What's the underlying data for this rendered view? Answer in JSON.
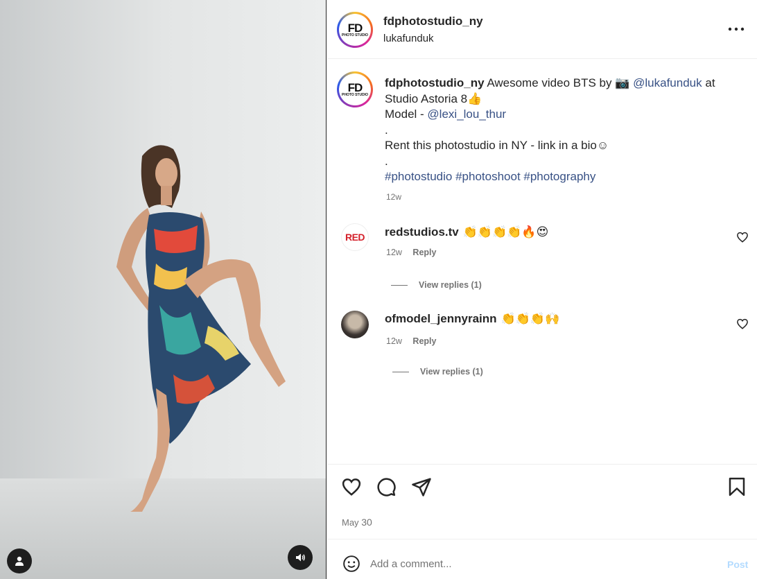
{
  "post": {
    "username": "fdphotostudio_ny",
    "subtitle": "lukafunduk",
    "avatar_text": "FD",
    "avatar_subtext": "PHOTO STUDIO"
  },
  "caption": {
    "username": "fdphotostudio_ny",
    "text_1": "Awesome video BTS by 📷",
    "mention_1": "@lukafunduk",
    "text_2": "at Studio Astoria 8👍",
    "model_prefix": "Model - ",
    "mention_2": "@lexi_lou_thur",
    "dot_1": ".",
    "rent_text": "Rent this photostudio in NY - link in a bio☺",
    "dot_2": ".",
    "hashtags": "#photostudio #photoshoot #photography",
    "time": "12w"
  },
  "comments": [
    {
      "username": "redstudios.tv",
      "emoji": "👏👏👏👏🔥😍",
      "time": "12w",
      "reply": "Reply",
      "view_replies": "View replies (1)",
      "avatar_text": "RED"
    },
    {
      "username": "ofmodel_jennyrainn",
      "emoji": "👏👏👏🙌",
      "time": "12w",
      "reply": "Reply",
      "view_replies": "View replies (1)"
    }
  ],
  "footer": {
    "date_month": "May",
    "date_day": "30",
    "comment_placeholder": "Add a comment...",
    "post_label": "Post"
  },
  "icons": {
    "more": "more-icon",
    "like": "heart-icon",
    "comment": "comment-icon",
    "share": "share-icon",
    "save": "bookmark-icon",
    "emoji": "emoji-icon",
    "user_tag": "user-icon",
    "sound": "sound-icon"
  },
  "colors": {
    "link": "#385185",
    "muted": "#737373",
    "post_disabled": "#b3dbff"
  }
}
